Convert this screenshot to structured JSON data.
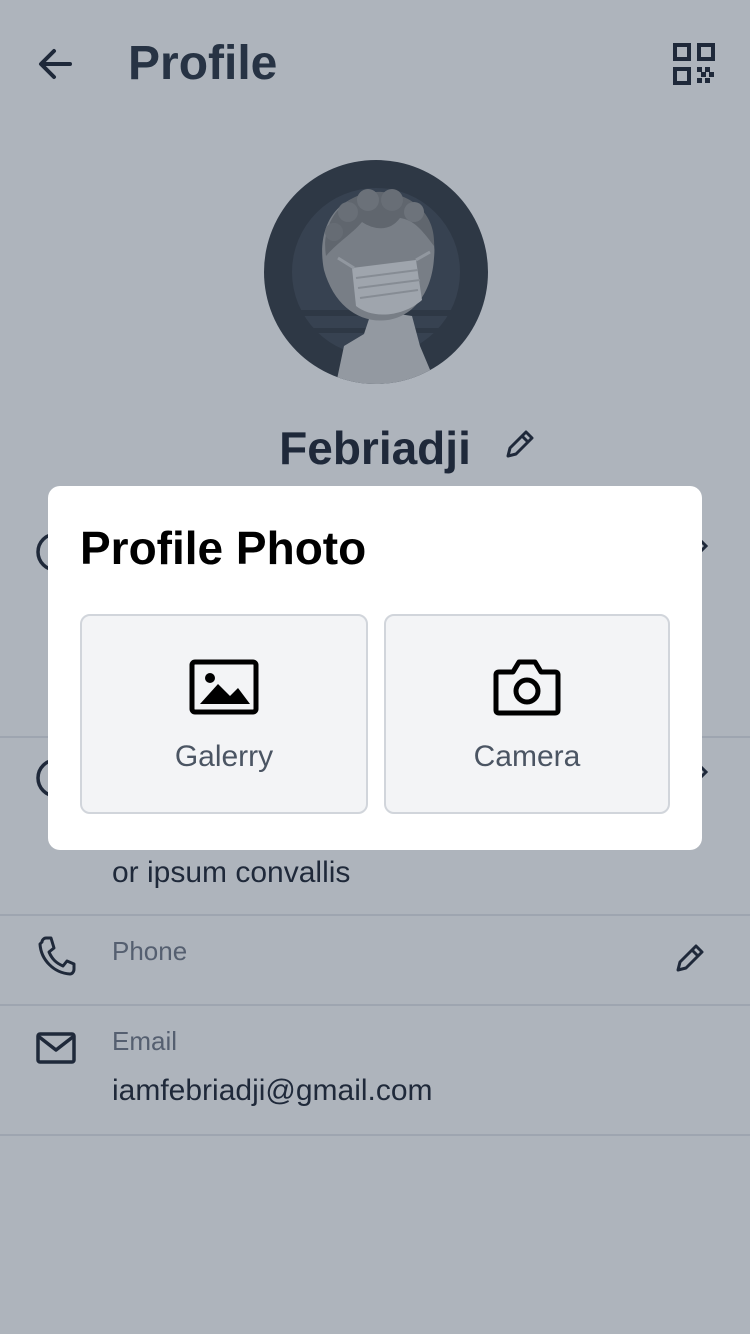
{
  "header": {
    "title": "Profile",
    "back_icon": "arrow-left-icon",
    "qr_icon": "qr-code-icon"
  },
  "profile": {
    "name": "Febriadji",
    "edit_icon": "pencil-icon"
  },
  "rows": {
    "about": {
      "value": "or ipsum convallis"
    },
    "phone": {
      "label": "Phone"
    },
    "email": {
      "label": "Email",
      "value": "iamfebriadji@gmail.com"
    }
  },
  "modal": {
    "title": "Profile Photo",
    "options": [
      {
        "label": "Galerry",
        "icon": "image-icon"
      },
      {
        "label": "Camera",
        "icon": "camera-icon"
      }
    ]
  },
  "colors": {
    "overlay": "#344458",
    "text_dark": "#111827",
    "muted": "#6b7280",
    "option_bg": "#f3f4f6"
  }
}
